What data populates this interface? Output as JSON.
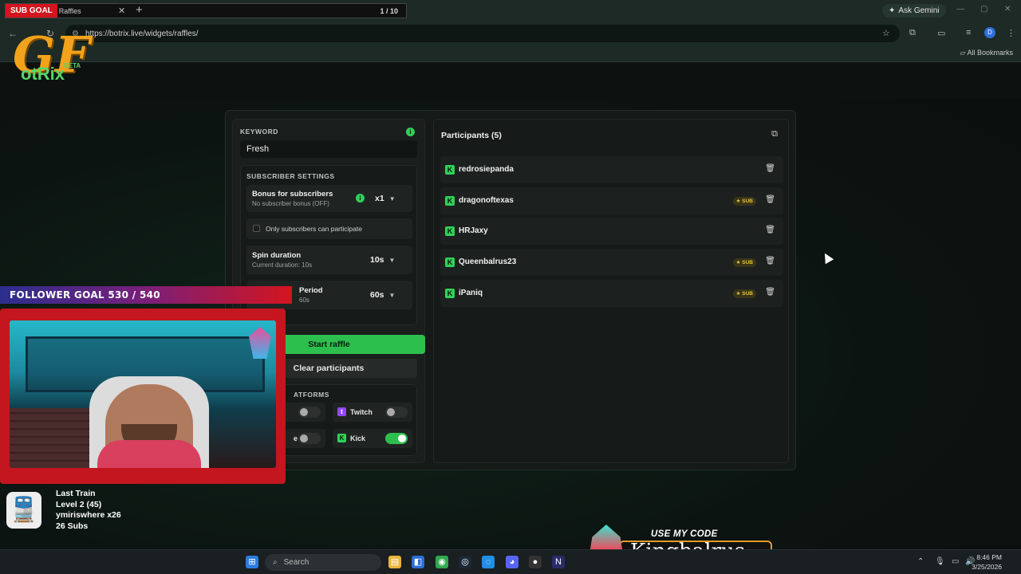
{
  "browser": {
    "tab_title": "Raffles",
    "url": "https://botrix.live/widgets/raffles/",
    "ask_gemini": "Ask Gemini",
    "all_bookmarks": "All Bookmarks",
    "profile_initial": "D"
  },
  "overlay": {
    "sub_goal_label": "SUB GOAL",
    "sub_goal_count": "1 / 10",
    "follower_goal": "FOLLOWER GOAL 530 / 540",
    "stream_info": [
      "Last Train",
      "Level 2  (45)",
      "ymiriswhere x26",
      "26 Subs"
    ],
    "code_heading": "USE MY CODE",
    "code_name": "Kingbalrus"
  },
  "app": {
    "logo_text": "otRix",
    "logo_badge": "BETA"
  },
  "raffle": {
    "keyword_label": "KEYWORD",
    "keyword_value": "Fresh",
    "subscriber_settings_label": "SUBSCRIBER SETTINGS",
    "bonus_title": "Bonus for subscribers",
    "bonus_sub": "No subscriber bonus (OFF)",
    "bonus_value": "x1",
    "only_subs_label": "Only subscribers can participate",
    "spin_title": "Spin duration",
    "spin_sub": "Current duration: 10s",
    "spin_value": "10s",
    "period_title": "Period",
    "period_sub": "60s",
    "period_value": "60s",
    "start_button": "Start raffle",
    "clear_button": "Clear participants",
    "platforms_label": "ATFORMS",
    "platforms": [
      {
        "name": "",
        "enabled": false
      },
      {
        "name": "Twitch",
        "enabled": false
      },
      {
        "name": "e",
        "enabled": false
      },
      {
        "name": "Kick",
        "enabled": true
      }
    ]
  },
  "participants": {
    "title": "Participants (5)",
    "list": [
      {
        "name": "redrosiepanda",
        "sub": false
      },
      {
        "name": "dragonoftexas",
        "sub": true
      },
      {
        "name": "HRJaxy",
        "sub": false
      },
      {
        "name": "Queenbalrus23",
        "sub": true
      },
      {
        "name": "iPaniq",
        "sub": true
      }
    ],
    "sub_badge": "★ SUB"
  },
  "taskbar": {
    "search_placeholder": "Search",
    "time": "8:46 PM",
    "date": "3/25/2026"
  },
  "colors": {
    "accent_green": "#2dbf4e",
    "kick_green": "#31d159",
    "sub_goal_red": "#d4141e",
    "sub_badge_gold": "#e6c23a"
  }
}
